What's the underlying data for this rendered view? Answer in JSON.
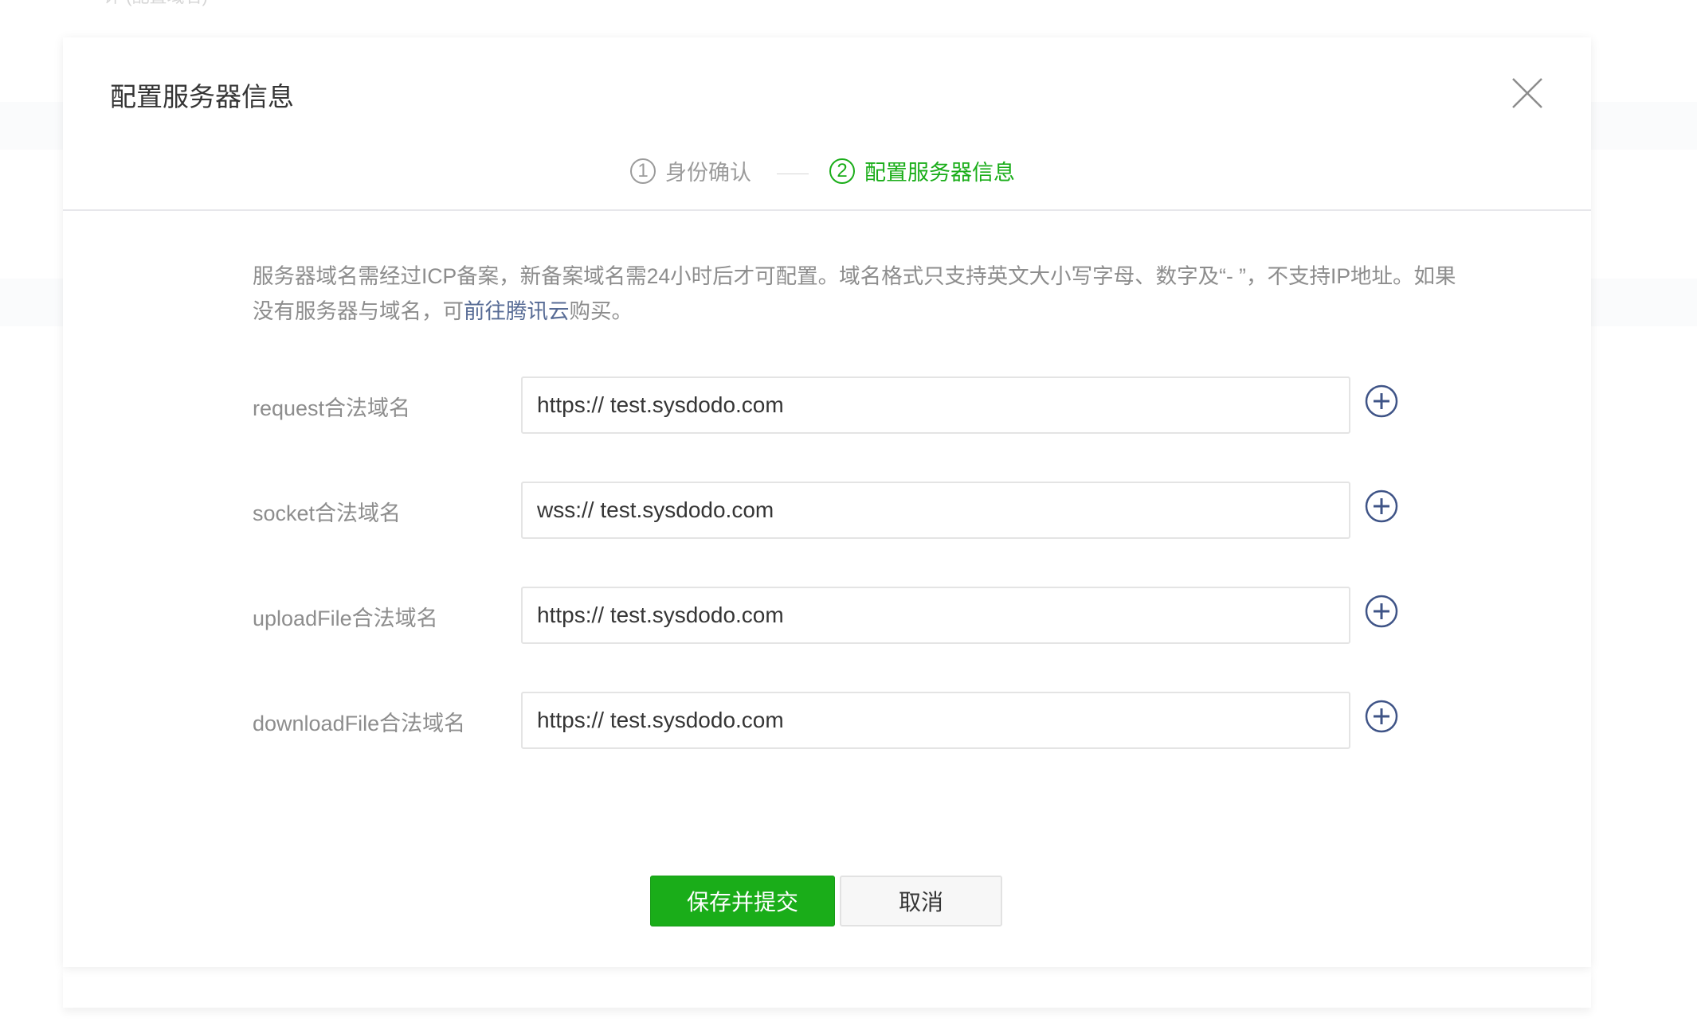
{
  "background": {
    "top_text": "详    (配置域名)"
  },
  "dialog": {
    "title": "配置服务器信息",
    "close_icon": "close-icon",
    "steps": [
      {
        "number": "1",
        "label": "身份确认",
        "state": "done"
      },
      {
        "number": "2",
        "label": "配置服务器信息",
        "state": "active"
      }
    ],
    "notice": {
      "text_before_link": "服务器域名需经过ICP备案，新备案域名需24小时后才可配置。域名格式只支持英文大小写字母、数字及“- ”，不支持IP地址。如果没有服务器与域名，可",
      "link_text": "前往腾讯云",
      "text_after_link": "购买。"
    },
    "fields": [
      {
        "label": "request合法域名",
        "value": "https:// test.sysdodo.com",
        "icon": "plus-circle-icon"
      },
      {
        "label": "socket合法域名",
        "value": "wss:// test.sysdodo.com",
        "icon": "plus-circle-icon"
      },
      {
        "label": "uploadFile合法域名",
        "value": "https:// test.sysdodo.com",
        "icon": "plus-circle-icon"
      },
      {
        "label": "downloadFile合法域名",
        "value": "https:// test.sysdodo.com",
        "icon": "plus-circle-icon"
      }
    ],
    "buttons": {
      "submit_label": "保存并提交",
      "cancel_label": "取消"
    }
  },
  "colors": {
    "primary_green": "#1aad19",
    "link_blue": "#576b95",
    "muted_text": "#8d8d8d",
    "icon_navy": "#3f5487"
  }
}
